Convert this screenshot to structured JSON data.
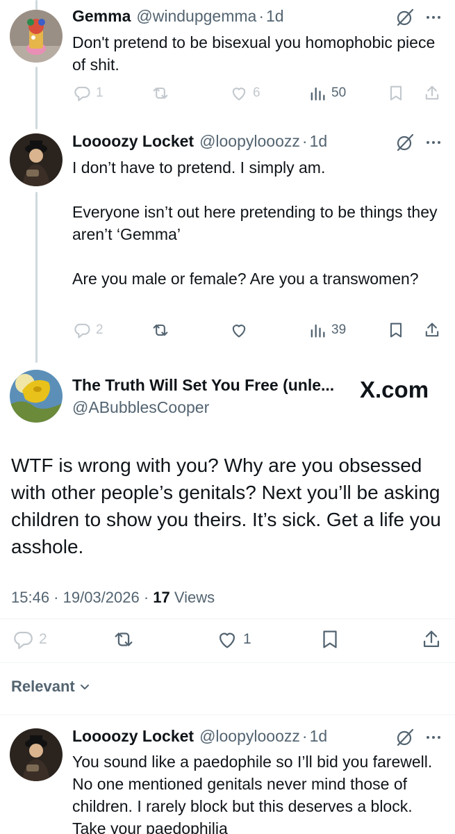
{
  "reply1": {
    "name": "Gemma",
    "handle": "@windupgemma",
    "sep": "·",
    "time": "1d",
    "text": "Don't pretend to be bisexual you homophobic piece of shit.",
    "stats": {
      "replies": "1",
      "reposts": "",
      "likes": "6",
      "views": "50"
    }
  },
  "reply2": {
    "name": "Loooozy Locket",
    "handle": "@loopylooozz",
    "sep": "·",
    "time": "1d",
    "text": "I don’t have to pretend. I simply am.\n\nEveryone isn’t out here pretending to be things they aren’t ‘Gemma’\n\nAre you male or female? Are you a transwomen?",
    "stats": {
      "replies": "2",
      "reposts": "",
      "likes": "",
      "views": "39"
    }
  },
  "main_post": {
    "name": "The Truth Will Set You Free (unle...",
    "handle": "@ABubblesCooper",
    "watermark": "X.com",
    "text": "WTF is wrong with you? Why are you obsessed with other people’s genitals? Next you’ll be asking children to show you theirs. It’s sick. Get a life you asshole.",
    "timestamp": "15:46 · 19/03/2026 · ",
    "views_count": "17",
    "views_label": " Views",
    "stats": {
      "replies": "2",
      "reposts": "",
      "likes": "1"
    }
  },
  "sort": {
    "label": "Relevant"
  },
  "reply3": {
    "name": "Loooozy Locket",
    "handle": "@loopylooozz",
    "sep": "·",
    "time": "1d",
    "text": "You sound like a paedophile so I’ll bid you farewell. No one mentioned genitals never mind those of children. I rarely block but this deserves a block. Take your paedophilia"
  },
  "colors": {
    "text": "#0f1419",
    "secondary": "#536471",
    "thread_line": "#cfd9de",
    "divider": "#eff3f4"
  },
  "icons": [
    "grok-icon",
    "more-icon",
    "reply-icon",
    "repost-icon",
    "like-icon",
    "views-icon",
    "bookmark-icon",
    "share-icon",
    "chevron-down-icon"
  ]
}
